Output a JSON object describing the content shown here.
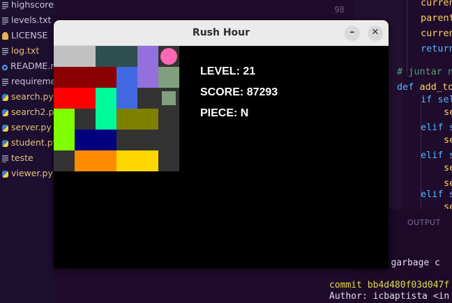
{
  "explorer": {
    "files": [
      {
        "name": "highscores.json",
        "icon": "json-icon",
        "color": "grey"
      },
      {
        "name": "levels.txt",
        "icon": "file-lines-icon",
        "color": "grey"
      },
      {
        "name": "LICENSE",
        "icon": "license-icon",
        "color": "grey"
      },
      {
        "name": "log.txt",
        "icon": "file-lines-icon",
        "color": "yellow"
      },
      {
        "name": "README.md",
        "icon": "info-icon",
        "color": "grey"
      },
      {
        "name": "requirements.txt",
        "icon": "file-lines-icon",
        "color": "grey"
      },
      {
        "name": "search.py",
        "icon": "python-icon",
        "color": "yellow"
      },
      {
        "name": "search2.py",
        "icon": "python-icon",
        "color": "yellow"
      },
      {
        "name": "server.py",
        "icon": "python-icon",
        "color": "yellow"
      },
      {
        "name": "student.py",
        "icon": "python-icon",
        "color": "yellow"
      },
      {
        "name": "teste",
        "icon": "file-lines-icon",
        "color": "yellow"
      },
      {
        "name": "viewer.py",
        "icon": "python-icon",
        "color": "yellow"
      }
    ]
  },
  "editor": {
    "line_number": "98",
    "code": [
      "current",
      "parent",
      "current",
      "return",
      "# juntar n",
      "def add_to",
      "if sel",
      "se",
      "elif s",
      "se",
      "elif s",
      "se",
      "se",
      "elif s",
      "se"
    ]
  },
  "panel": {
    "output_tab": "OUTPUT",
    "terminal": [
      "ng garbage c",
      "commit bb4d480f03d047f",
      "Author: icbaptista <in"
    ]
  },
  "window": {
    "title": "Rush Hour",
    "minimize_label": "–",
    "close_label": "✕"
  },
  "game": {
    "level_label": "LEVEL:",
    "level": "21",
    "score_label": "SCORE:",
    "score": "87293",
    "piece_label": "PIECE:",
    "piece": "N",
    "grid_size": 6,
    "empty_color": "#333333",
    "cells": [
      {
        "row": 0,
        "col": 0,
        "w": 2,
        "h": 1,
        "color": "#c0c0c0"
      },
      {
        "row": 0,
        "col": 2,
        "w": 2,
        "h": 1,
        "color": "#2f4f4f"
      },
      {
        "row": 0,
        "col": 4,
        "w": 1,
        "h": 2,
        "color": "#9370db"
      },
      {
        "row": 0,
        "col": 5,
        "w": 1,
        "h": 1,
        "color": "#ff69b4",
        "shape": "circle"
      },
      {
        "row": 1,
        "col": 0,
        "w": 3,
        "h": 1,
        "color": "#8b0000"
      },
      {
        "row": 1,
        "col": 3,
        "w": 1,
        "h": 2,
        "color": "#4169e1"
      },
      {
        "row": 1,
        "col": 5,
        "w": 1,
        "h": 1,
        "color": "#7f9f7f"
      },
      {
        "row": 2,
        "col": 0,
        "w": 2,
        "h": 1,
        "color": "#ff0000"
      },
      {
        "row": 2,
        "col": 2,
        "w": 1,
        "h": 2,
        "color": "#00fa9a"
      },
      {
        "row": 2,
        "col": 5,
        "w": 1,
        "h": 1,
        "color": "#7f9f7f",
        "shape": "small"
      },
      {
        "row": 3,
        "col": 0,
        "w": 1,
        "h": 2,
        "color": "#7fff00"
      },
      {
        "row": 3,
        "col": 3,
        "w": 2,
        "h": 1,
        "color": "#808000"
      },
      {
        "row": 4,
        "col": 1,
        "w": 2,
        "h": 1,
        "color": "#000080"
      },
      {
        "row": 5,
        "col": 1,
        "w": 2,
        "h": 1,
        "color": "#ff8c00"
      },
      {
        "row": 5,
        "col": 3,
        "w": 2,
        "h": 1,
        "color": "#ffd700"
      }
    ]
  }
}
